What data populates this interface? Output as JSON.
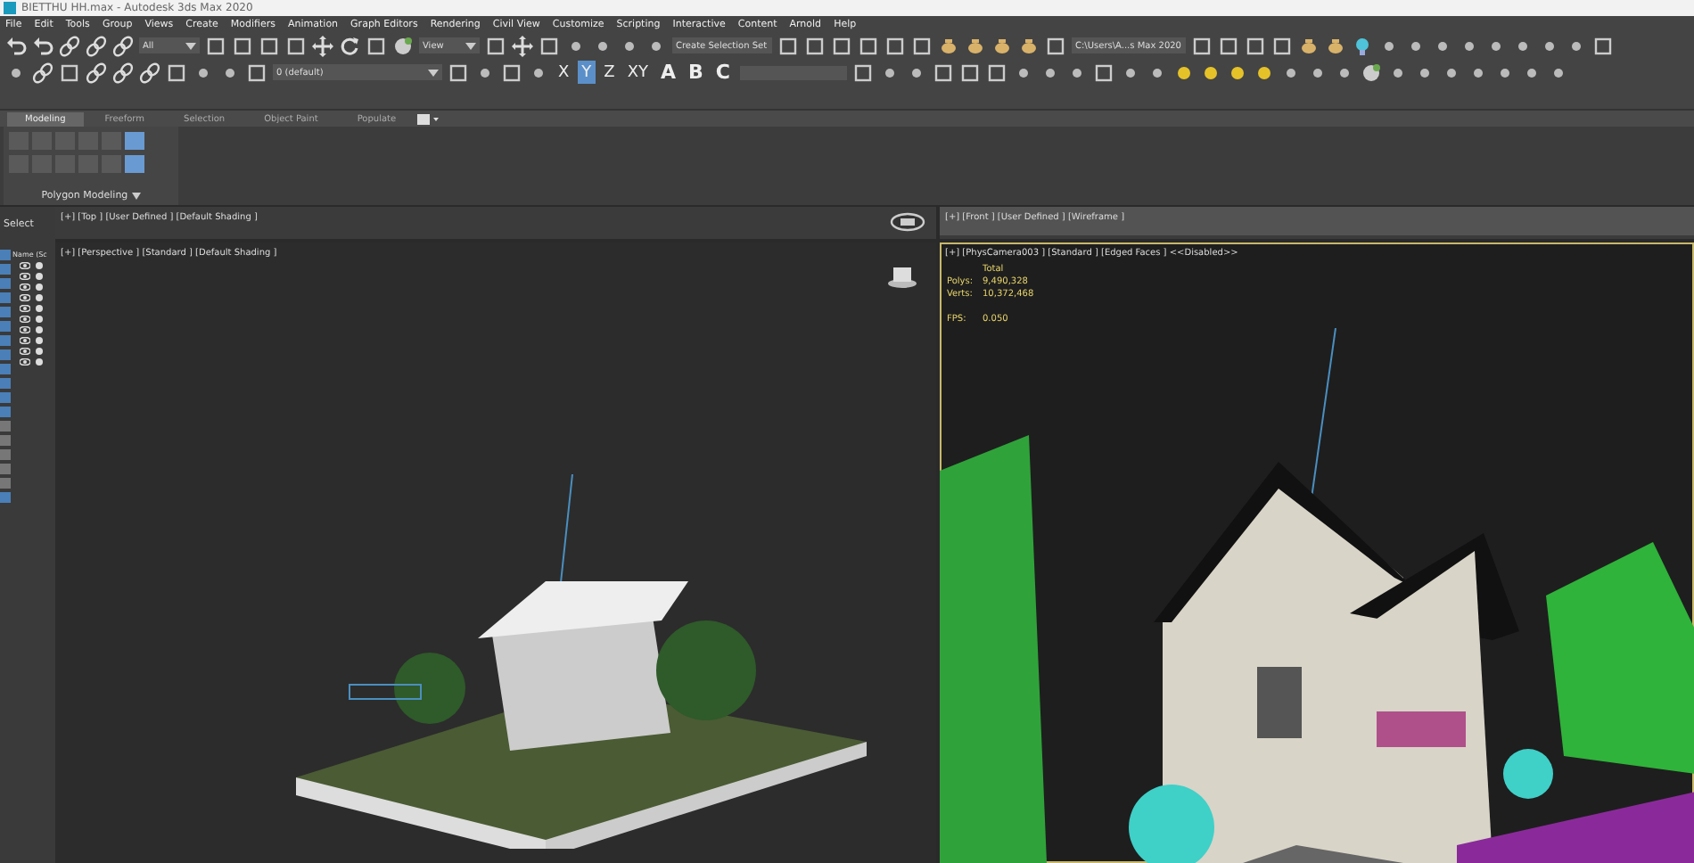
{
  "window": {
    "title": "BIETTHU HH.max - Autodesk 3ds Max 2020"
  },
  "menu": [
    "File",
    "Edit",
    "Tools",
    "Group",
    "Views",
    "Create",
    "Modifiers",
    "Animation",
    "Graph Editors",
    "Rendering",
    "Civil View",
    "Customize",
    "Scripting",
    "Interactive",
    "Content",
    "Arnold",
    "Help"
  ],
  "toolbar": {
    "selection_filter": "All",
    "reference_coord": "View",
    "selection_set": "Create Selection Set",
    "project_path": "C:\\Users\\A...s Max 2020",
    "layer": "0 (default)",
    "axes": [
      {
        "label": "X",
        "selected": false
      },
      {
        "label": "Y",
        "selected": true
      },
      {
        "label": "Z",
        "selected": false
      },
      {
        "label": "XY",
        "selected": false
      }
    ],
    "snap_letters": [
      "A",
      "B",
      "C"
    ]
  },
  "ribbon": {
    "tabs": [
      {
        "label": "Modeling",
        "selected": true
      },
      {
        "label": "Freeform",
        "selected": false
      },
      {
        "label": "Selection",
        "selected": false
      },
      {
        "label": "Object Paint",
        "selected": false
      },
      {
        "label": "Populate",
        "selected": false
      }
    ],
    "panel_title": "Polygon Modeling"
  },
  "command_panel": {
    "label": "Select"
  },
  "scene_explorer": {
    "column": "Name (Sc",
    "rows": [
      {
        "visible": true
      },
      {
        "visible": true
      },
      {
        "visible": true
      },
      {
        "visible": true
      },
      {
        "visible": true
      },
      {
        "visible": true
      },
      {
        "visible": true
      },
      {
        "visible": true
      },
      {
        "visible": true
      },
      {
        "visible": true
      }
    ]
  },
  "viewports": [
    {
      "kind": "strip",
      "label": "[+] [Top ] [User Defined ] [Default Shading ]",
      "active": false
    },
    {
      "kind": "strip",
      "label": "[+] [Front ] [User Defined ] [Wireframe ]",
      "active": false
    },
    {
      "kind": "perspective",
      "label": "[+] [Perspective ] [Standard ] [Default Shading ]",
      "active": false
    },
    {
      "kind": "camera",
      "label": "[+] [PhysCamera003 ] [Standard ] [Edged Faces ]  <<Disabled>>",
      "active": true,
      "stats": {
        "header": "Total",
        "rows": [
          {
            "label": "Polys:",
            "value": "9,490,328"
          },
          {
            "label": "Verts:",
            "value": "10,372,468"
          },
          {
            "label": "FPS:",
            "value": "0.050"
          }
        ]
      }
    }
  ]
}
